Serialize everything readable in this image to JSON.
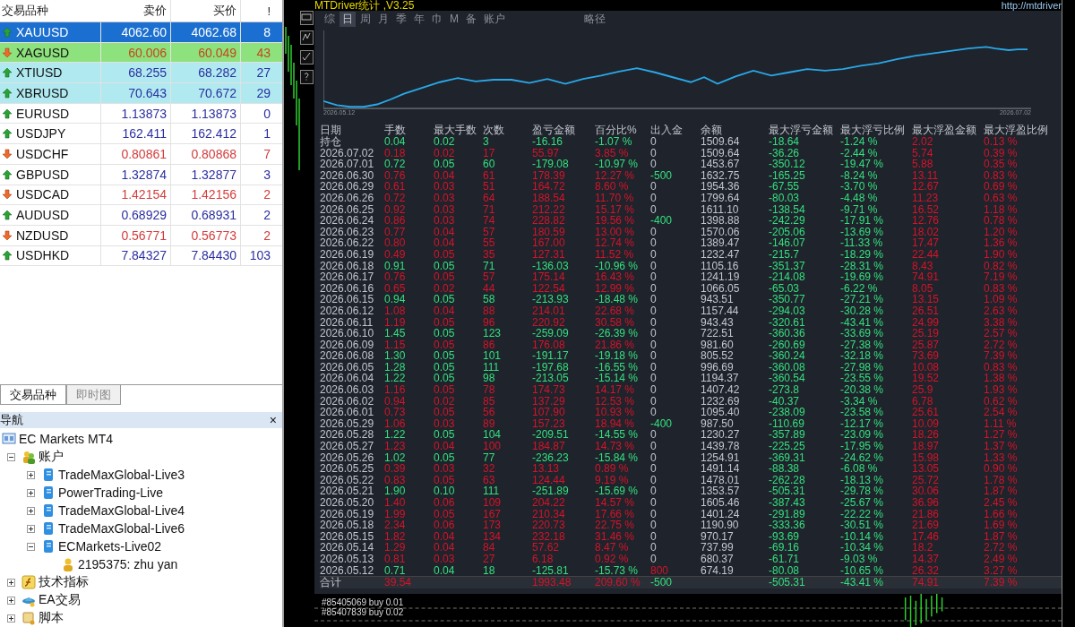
{
  "market_watch": {
    "columns": [
      "交易品种",
      "卖价",
      "买价",
      "!"
    ],
    "rows": [
      {
        "symbol": "XAUUSD",
        "bid": "4062.60",
        "ask": "4062.68",
        "spread": "8",
        "rising": true,
        "selected": true
      },
      {
        "symbol": "XAGUSD",
        "bid": "60.006",
        "ask": "60.049",
        "spread": "43",
        "rising": false,
        "selected": false,
        "color": "#8ee27e"
      },
      {
        "symbol": "XTIUSD",
        "bid": "68.255",
        "ask": "68.282",
        "spread": "27",
        "rising": true,
        "selected": false,
        "color": "#b0eaf0"
      },
      {
        "symbol": "XBRUSD",
        "bid": "70.643",
        "ask": "70.672",
        "spread": "29",
        "rising": true,
        "selected": false,
        "color": "#b0eaf0"
      },
      {
        "symbol": "EURUSD",
        "bid": "1.13873",
        "ask": "1.13873",
        "spread": "0",
        "rising": true,
        "selected": false
      },
      {
        "symbol": "USDJPY",
        "bid": "162.411",
        "ask": "162.412",
        "spread": "1",
        "rising": true,
        "selected": false
      },
      {
        "symbol": "USDCHF",
        "bid": "0.80861",
        "ask": "0.80868",
        "spread": "7",
        "rising": false,
        "selected": false
      },
      {
        "symbol": "GBPUSD",
        "bid": "1.32874",
        "ask": "1.32877",
        "spread": "3",
        "rising": true,
        "selected": false
      },
      {
        "symbol": "USDCAD",
        "bid": "1.42154",
        "ask": "1.42156",
        "spread": "2",
        "rising": false,
        "selected": false
      },
      {
        "symbol": "AUDUSD",
        "bid": "0.68929",
        "ask": "0.68931",
        "spread": "2",
        "rising": true,
        "selected": false
      },
      {
        "symbol": "NZDUSD",
        "bid": "0.56771",
        "ask": "0.56773",
        "spread": "2",
        "rising": false,
        "selected": false
      },
      {
        "symbol": "USDHKD",
        "bid": "7.84327",
        "ask": "7.84430",
        "spread": "103",
        "rising": true,
        "selected": false
      }
    ],
    "tabs": [
      {
        "label": "交易品种",
        "selected": true
      },
      {
        "label": "即时图",
        "selected": false
      }
    ]
  },
  "navigator": {
    "title": "导航",
    "close": "×",
    "tree": [
      {
        "label": "EC Markets MT4",
        "kind": "terminal",
        "children": [
          {
            "label": "账户",
            "kind": "accounts",
            "expanded": true,
            "children": [
              {
                "label": "TradeMaxGlobal-Live3",
                "kind": "server",
                "expanded": false
              },
              {
                "label": "PowerTrading-Live",
                "kind": "server",
                "expanded": false
              },
              {
                "label": "TradeMaxGlobal-Live4",
                "kind": "server",
                "expanded": false
              },
              {
                "label": "TradeMaxGlobal-Live6",
                "kind": "server",
                "expanded": false
              },
              {
                "label": "ECMarkets-Live02",
                "kind": "server",
                "expanded": true,
                "children": [
                  {
                    "label": "2195375: zhu yan",
                    "kind": "user"
                  }
                ]
              }
            ]
          },
          {
            "label": "技术指标",
            "kind": "indicators",
            "expanded": false
          },
          {
            "label": "EA交易",
            "kind": "experts",
            "expanded": false
          },
          {
            "label": "脚本",
            "kind": "scripts",
            "expanded": false
          }
        ]
      }
    ]
  },
  "stats": {
    "title": "MTDriver统计 ,V3.25",
    "url": "http://mtdriver",
    "tabs": [
      {
        "label": "综",
        "selected": false
      },
      {
        "label": "日",
        "selected": true
      },
      {
        "label": "周",
        "selected": false
      },
      {
        "label": "月",
        "selected": false
      },
      {
        "label": "季",
        "selected": false
      },
      {
        "label": "年",
        "selected": false
      },
      {
        "label": "巾",
        "selected": false
      },
      {
        "label": "M",
        "selected": false
      },
      {
        "label": "备",
        "selected": false
      },
      {
        "label": "账户",
        "selected": false
      }
    ],
    "path_label": "略径",
    "chart_start": "2026.05.12",
    "chart_end": "2026.07.02",
    "date_header": "日期",
    "columns": [
      {
        "label": "手数",
        "kind": "trade"
      },
      {
        "label": "最大手数",
        "kind": "trade"
      },
      {
        "label": "次数",
        "kind": "trade"
      },
      {
        "label": "盈亏金额",
        "kind": "trade"
      },
      {
        "label": "百分比%",
        "kind": "trade"
      },
      {
        "label": "出入金",
        "kind": "flow"
      },
      {
        "label": "余额",
        "kind": "balance"
      },
      {
        "label": "最大浮亏金额",
        "kind": "drawdown"
      },
      {
        "label": "最大浮亏比例",
        "kind": "drawdown"
      },
      {
        "label": "最大浮盈金额",
        "kind": "runup"
      },
      {
        "label": "最大浮盈比例",
        "kind": "runup"
      }
    ],
    "rows": [
      {
        "date": "持仓",
        "profit": false,
        "withdrawal": false,
        "deposit": false,
        "cells": [
          "0.04",
          "0.02",
          "3",
          "-16.16",
          "-1.07 %",
          "0",
          "1509.64",
          "-18.64",
          "-1.24 %",
          "2.02",
          "0.13 %"
        ]
      },
      {
        "date": "2026.07.02",
        "profit": true,
        "withdrawal": false,
        "deposit": false,
        "cells": [
          "0.18",
          "0.02",
          "17",
          "55.97",
          "3.85 %",
          "0",
          "1509.64",
          "-36.26",
          "-2.44 %",
          "5.74",
          "0.39 %"
        ]
      },
      {
        "date": "2026.07.01",
        "profit": false,
        "withdrawal": false,
        "deposit": false,
        "cells": [
          "0.72",
          "0.05",
          "60",
          "-179.08",
          "-10.97 %",
          "0",
          "1453.67",
          "-350.12",
          "-19.47 %",
          "5.88",
          "0.35 %"
        ]
      },
      {
        "date": "2026.06.30",
        "profit": true,
        "withdrawal": true,
        "deposit": false,
        "cells": [
          "0.76",
          "0.04",
          "61",
          "178.39",
          "12.27 %",
          "-500",
          "1632.75",
          "-165.25",
          "-8.24 %",
          "13.11",
          "0.83 %"
        ]
      },
      {
        "date": "2026.06.29",
        "profit": true,
        "withdrawal": false,
        "deposit": false,
        "cells": [
          "0.61",
          "0.03",
          "51",
          "164.72",
          "8.60 %",
          "0",
          "1954.36",
          "-67.55",
          "-3.70 %",
          "12.67",
          "0.69 %"
        ]
      },
      {
        "date": "2026.06.26",
        "profit": true,
        "withdrawal": false,
        "deposit": false,
        "cells": [
          "0.72",
          "0.03",
          "64",
          "188.54",
          "11.70 %",
          "0",
          "1799.64",
          "-80.03",
          "-4.48 %",
          "11.23",
          "0.63 %"
        ]
      },
      {
        "date": "2026.06.25",
        "profit": true,
        "withdrawal": false,
        "deposit": false,
        "cells": [
          "0.92",
          "0.03",
          "71",
          "212.22",
          "15.17 %",
          "0",
          "1611.10",
          "-138.54",
          "-9.71 %",
          "16.52",
          "1.18 %"
        ]
      },
      {
        "date": "2026.06.24",
        "profit": true,
        "withdrawal": true,
        "deposit": false,
        "cells": [
          "0.86",
          "0.03",
          "74",
          "228.82",
          "19.56 %",
          "-400",
          "1398.88",
          "-242.29",
          "-17.91 %",
          "12.76",
          "0.78 %"
        ]
      },
      {
        "date": "2026.06.23",
        "profit": true,
        "withdrawal": false,
        "deposit": false,
        "cells": [
          "0.77",
          "0.04",
          "57",
          "180.59",
          "13.00 %",
          "0",
          "1570.06",
          "-205.06",
          "-13.69 %",
          "18.02",
          "1.20 %"
        ]
      },
      {
        "date": "2026.06.22",
        "profit": true,
        "withdrawal": false,
        "deposit": false,
        "cells": [
          "0.80",
          "0.04",
          "55",
          "167.00",
          "12.74 %",
          "0",
          "1389.47",
          "-146.07",
          "-11.33 %",
          "17.47",
          "1.36 %"
        ]
      },
      {
        "date": "2026.06.19",
        "profit": true,
        "withdrawal": false,
        "deposit": false,
        "cells": [
          "0.49",
          "0.05",
          "35",
          "127.31",
          "11.52 %",
          "0",
          "1232.47",
          "-215.7",
          "-18.29 %",
          "22.44",
          "1.90 %"
        ]
      },
      {
        "date": "2026.06.18",
        "profit": false,
        "withdrawal": false,
        "deposit": false,
        "cells": [
          "0.91",
          "0.05",
          "71",
          "-136.03",
          "-10.96 %",
          "0",
          "1105.16",
          "-351.37",
          "-28.31 %",
          "8.43",
          "0.82 %"
        ]
      },
      {
        "date": "2026.06.17",
        "profit": true,
        "withdrawal": false,
        "deposit": false,
        "cells": [
          "0.76",
          "0.05",
          "57",
          "175.14",
          "16.43 %",
          "0",
          "1241.19",
          "-214.08",
          "-19.69 %",
          "74.91",
          "7.19 %"
        ]
      },
      {
        "date": "2026.06.16",
        "profit": true,
        "withdrawal": false,
        "deposit": false,
        "cells": [
          "0.65",
          "0.02",
          "44",
          "122.54",
          "12.99 %",
          "0",
          "1066.05",
          "-65.03",
          "-6.22 %",
          "8.05",
          "0.83 %"
        ]
      },
      {
        "date": "2026.06.15",
        "profit": false,
        "withdrawal": false,
        "deposit": false,
        "cells": [
          "0.94",
          "0.05",
          "58",
          "-213.93",
          "-18.48 %",
          "0",
          "943.51",
          "-350.77",
          "-27.21 %",
          "13.15",
          "1.09 %"
        ]
      },
      {
        "date": "2026.06.12",
        "profit": true,
        "withdrawal": false,
        "deposit": false,
        "cells": [
          "1.08",
          "0.04",
          "88",
          "214.01",
          "22.68 %",
          "0",
          "1157.44",
          "-294.03",
          "-30.28 %",
          "26.51",
          "2.63 %"
        ]
      },
      {
        "date": "2026.06.11",
        "profit": true,
        "withdrawal": false,
        "deposit": false,
        "cells": [
          "1.19",
          "0.05",
          "96",
          "220.92",
          "30.58 %",
          "0",
          "943.43",
          "-320.61",
          "-43.41 %",
          "24.99",
          "3.38 %"
        ]
      },
      {
        "date": "2026.06.10",
        "profit": false,
        "withdrawal": false,
        "deposit": false,
        "cells": [
          "1.45",
          "0.05",
          "123",
          "-259.09",
          "-26.39 %",
          "0",
          "722.51",
          "-360.36",
          "-33.69 %",
          "25.19",
          "2.57 %"
        ]
      },
      {
        "date": "2026.06.09",
        "profit": true,
        "withdrawal": false,
        "deposit": false,
        "cells": [
          "1.15",
          "0.05",
          "86",
          "176.08",
          "21.86 %",
          "0",
          "981.60",
          "-260.69",
          "-27.38 %",
          "25.87",
          "2.72 %"
        ]
      },
      {
        "date": "2026.06.08",
        "profit": false,
        "withdrawal": false,
        "deposit": false,
        "cells": [
          "1.30",
          "0.05",
          "101",
          "-191.17",
          "-19.18 %",
          "0",
          "805.52",
          "-360.24",
          "-32.18 %",
          "73.69",
          "7.39 %"
        ]
      },
      {
        "date": "2026.06.05",
        "profit": false,
        "withdrawal": false,
        "deposit": false,
        "cells": [
          "1.28",
          "0.05",
          "111",
          "-197.68",
          "-16.55 %",
          "0",
          "996.69",
          "-360.08",
          "-27.98 %",
          "10.08",
          "0.83 %"
        ]
      },
      {
        "date": "2026.06.04",
        "profit": false,
        "withdrawal": false,
        "deposit": false,
        "cells": [
          "1.22",
          "0.05",
          "98",
          "-213.05",
          "-15.14 %",
          "0",
          "1194.37",
          "-360.54",
          "-23.55 %",
          "19.52",
          "1.38 %"
        ]
      },
      {
        "date": "2026.06.03",
        "profit": true,
        "withdrawal": false,
        "deposit": false,
        "cells": [
          "1.16",
          "0.05",
          "78",
          "174.73",
          "14.17 %",
          "0",
          "1407.42",
          "-273.8",
          "-20.38 %",
          "25.9",
          "1.93 %"
        ]
      },
      {
        "date": "2026.06.02",
        "profit": true,
        "withdrawal": false,
        "deposit": false,
        "cells": [
          "0.94",
          "0.02",
          "85",
          "137.29",
          "12.53 %",
          "0",
          "1232.69",
          "-40.37",
          "-3.34 %",
          "6.78",
          "0.62 %"
        ]
      },
      {
        "date": "2026.06.01",
        "profit": true,
        "withdrawal": false,
        "deposit": false,
        "cells": [
          "0.73",
          "0.05",
          "56",
          "107.90",
          "10.93 %",
          "0",
          "1095.40",
          "-238.09",
          "-23.58 %",
          "25.61",
          "2.54 %"
        ]
      },
      {
        "date": "2026.05.29",
        "profit": true,
        "withdrawal": true,
        "deposit": false,
        "cells": [
          "1.06",
          "0.03",
          "89",
          "157.23",
          "18.94 %",
          "-400",
          "987.50",
          "-110.69",
          "-12.17 %",
          "10.09",
          "1.11 %"
        ]
      },
      {
        "date": "2026.05.28",
        "profit": false,
        "withdrawal": false,
        "deposit": false,
        "cells": [
          "1.22",
          "0.05",
          "104",
          "-209.51",
          "-14.55 %",
          "0",
          "1230.27",
          "-357.89",
          "-23.09 %",
          "18.26",
          "1.27 %"
        ]
      },
      {
        "date": "2026.05.27",
        "profit": true,
        "withdrawal": false,
        "deposit": false,
        "cells": [
          "1.23",
          "0.04",
          "100",
          "184.87",
          "14.73 %",
          "0",
          "1439.78",
          "-225.25",
          "-17.95 %",
          "18.97",
          "1.37 %"
        ]
      },
      {
        "date": "2026.05.26",
        "profit": false,
        "withdrawal": false,
        "deposit": false,
        "cells": [
          "1.02",
          "0.05",
          "77",
          "-236.23",
          "-15.84 %",
          "0",
          "1254.91",
          "-369.31",
          "-24.62 %",
          "15.98",
          "1.33 %"
        ]
      },
      {
        "date": "2026.05.25",
        "profit": true,
        "withdrawal": false,
        "deposit": false,
        "cells": [
          "0.39",
          "0.03",
          "32",
          "13.13",
          "0.89 %",
          "0",
          "1491.14",
          "-88.38",
          "-6.08 %",
          "13.05",
          "0.90 %"
        ]
      },
      {
        "date": "2026.05.22",
        "profit": true,
        "withdrawal": false,
        "deposit": false,
        "cells": [
          "0.83",
          "0.05",
          "63",
          "124.44",
          "9.19 %",
          "0",
          "1478.01",
          "-262.28",
          "-18.13 %",
          "25.72",
          "1.78 %"
        ]
      },
      {
        "date": "2026.05.21",
        "profit": false,
        "withdrawal": false,
        "deposit": false,
        "cells": [
          "1.90",
          "0.10",
          "111",
          "-251.89",
          "-15.69 %",
          "0",
          "1353.57",
          "-505.31",
          "-29.78 %",
          "30.06",
          "1.87 %"
        ]
      },
      {
        "date": "2026.05.20",
        "profit": true,
        "withdrawal": false,
        "deposit": false,
        "cells": [
          "1.40",
          "0.06",
          "109",
          "204.22",
          "14.57 %",
          "0",
          "1605.46",
          "-387.43",
          "-25.67 %",
          "36.96",
          "2.45 %"
        ]
      },
      {
        "date": "2026.05.19",
        "profit": true,
        "withdrawal": false,
        "deposit": false,
        "cells": [
          "1.99",
          "0.05",
          "167",
          "210.34",
          "17.66 %",
          "0",
          "1401.24",
          "-291.89",
          "-22.22 %",
          "21.86",
          "1.66 %"
        ]
      },
      {
        "date": "2026.05.18",
        "profit": true,
        "withdrawal": false,
        "deposit": false,
        "cells": [
          "2.34",
          "0.06",
          "173",
          "220.73",
          "22.75 %",
          "0",
          "1190.90",
          "-333.36",
          "-30.51 %",
          "21.69",
          "1.69 %"
        ]
      },
      {
        "date": "2026.05.15",
        "profit": true,
        "withdrawal": false,
        "deposit": false,
        "cells": [
          "1.82",
          "0.04",
          "134",
          "232.18",
          "31.46 %",
          "0",
          "970.17",
          "-93.69",
          "-10.14 %",
          "17.46",
          "1.87 %"
        ]
      },
      {
        "date": "2026.05.14",
        "profit": true,
        "withdrawal": false,
        "deposit": false,
        "cells": [
          "1.29",
          "0.04",
          "84",
          "57.62",
          "8.47 %",
          "0",
          "737.99",
          "-69.16",
          "-10.34 %",
          "18.2",
          "2.72 %"
        ]
      },
      {
        "date": "2026.05.13",
        "profit": true,
        "withdrawal": false,
        "deposit": false,
        "cells": [
          "0.81",
          "0.03",
          "27",
          "6.18",
          "0.92 %",
          "0",
          "680.37",
          "-61.71",
          "-9.03 %",
          "14.37",
          "2.49 %"
        ]
      },
      {
        "date": "2026.05.12",
        "profit": false,
        "withdrawal": false,
        "deposit": true,
        "cells": [
          "0.71",
          "0.04",
          "18",
          "-125.81",
          "-15.73 %",
          "800",
          "674.19",
          "-80.08",
          "-10.65 %",
          "26.32",
          "3.27 %"
        ]
      }
    ],
    "total": {
      "date": "合计",
      "profit": true,
      "withdrawal": true,
      "deposit": false,
      "cells": [
        "39.54",
        null,
        null,
        "1993.48",
        "209.60 %",
        "-500",
        null,
        "-505.31",
        "-43.41 %",
        "74.91",
        "7.39 %"
      ]
    },
    "orders": [
      "#85405069 buy 0.01",
      "#85407839 buy 0.02"
    ]
  }
}
